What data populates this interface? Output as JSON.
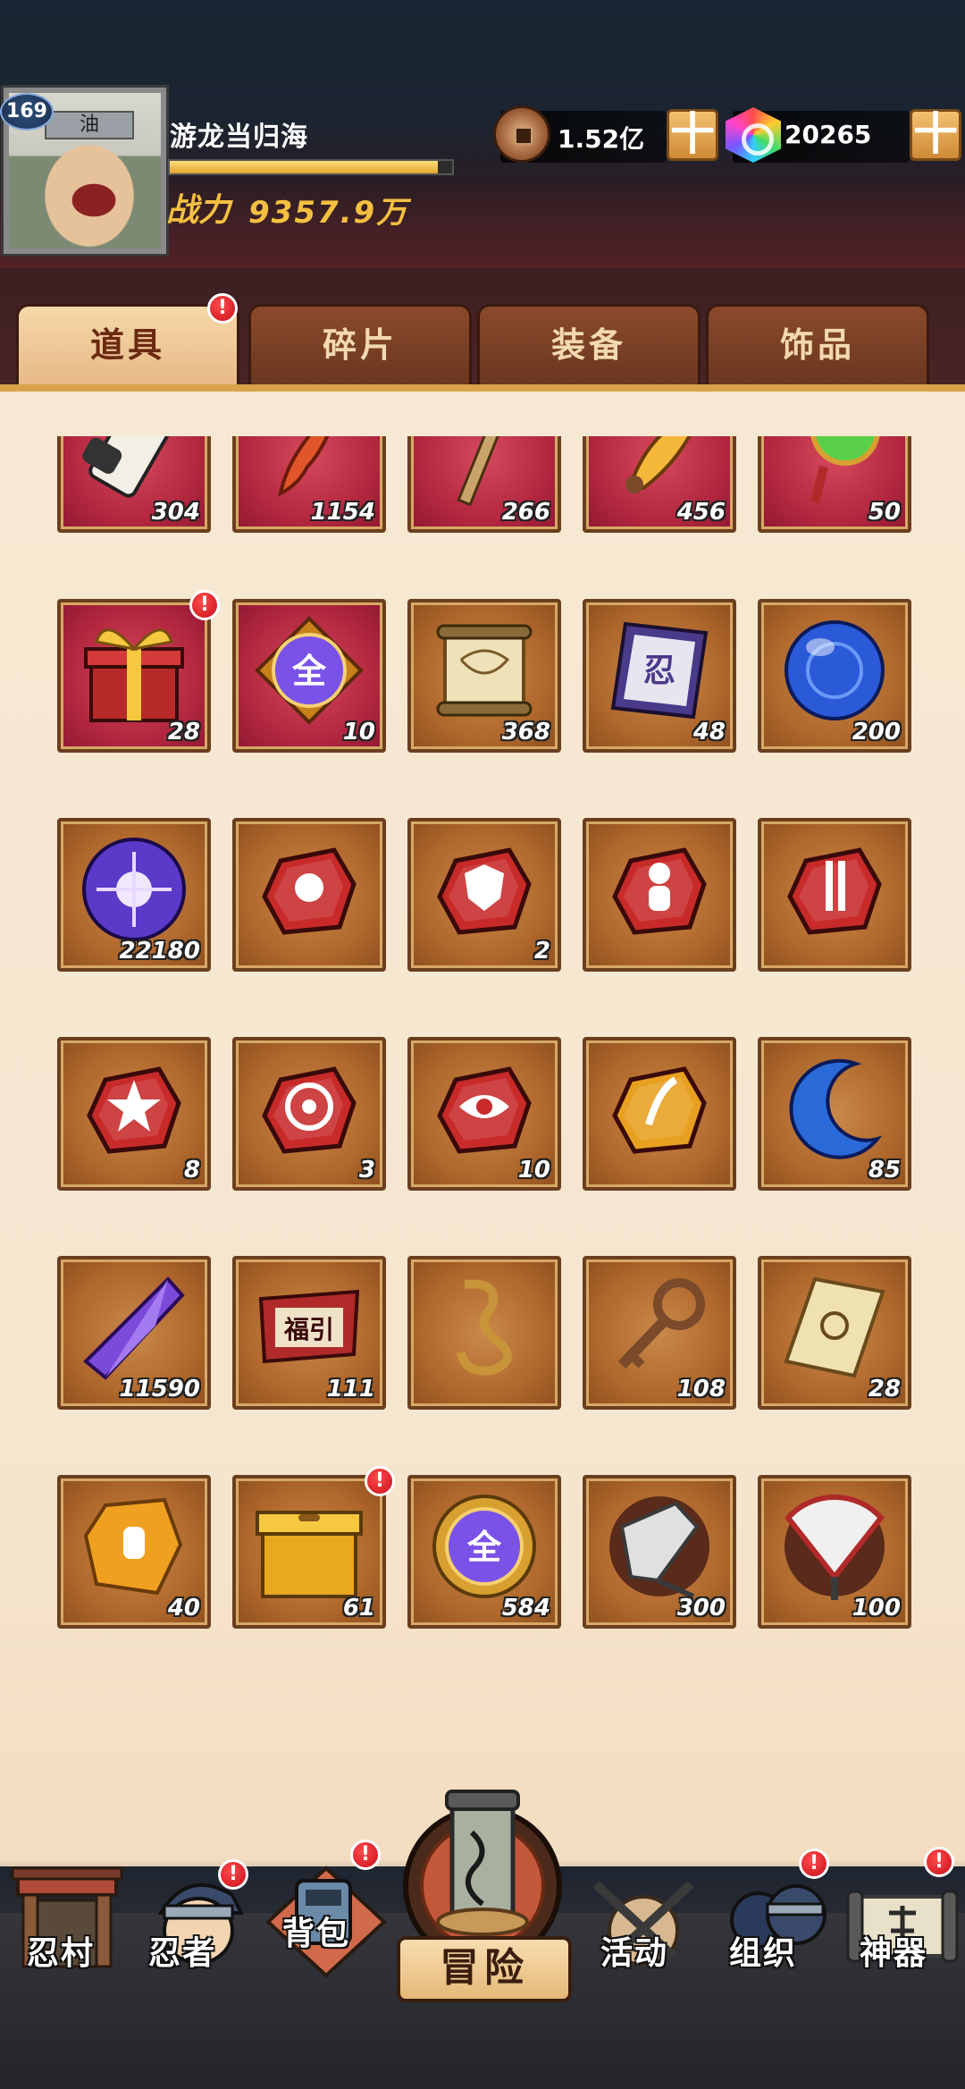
{
  "player": {
    "level": "169",
    "name": "游龙当归海",
    "power_label": "战力",
    "power_value": "9357.9万",
    "exp_fraction": 0.95,
    "avatar_band_text": "油"
  },
  "currencies": {
    "coins": {
      "amount": "1.52亿",
      "icon": "copper-coin-icon"
    },
    "gems": {
      "amount": "20265",
      "icon": "rainbow-gem-icon"
    },
    "plus_symbol": "十"
  },
  "tabs": [
    {
      "label": "道具",
      "active": true,
      "badge": "!"
    },
    {
      "label": "碎片",
      "active": false
    },
    {
      "label": "装备",
      "active": false
    },
    {
      "label": "饰品",
      "active": false
    }
  ],
  "items": [
    {
      "count": "304",
      "bg": "red",
      "icon": "scroll-icon"
    },
    {
      "count": "1154",
      "bg": "red",
      "icon": "flame-feather-icon"
    },
    {
      "count": "266",
      "bg": "red",
      "icon": "stick-icon"
    },
    {
      "count": "456",
      "bg": "red",
      "icon": "golden-feather-icon"
    },
    {
      "count": "50",
      "bg": "red",
      "icon": "green-jade-icon"
    },
    {
      "count": "28",
      "bg": "red",
      "icon": "gift-box-icon",
      "badge": "!"
    },
    {
      "count": "10",
      "bg": "red",
      "icon": "purple-orb-quan-icon",
      "orb_text": "全"
    },
    {
      "count": "368",
      "bg": "brown",
      "icon": "map-scroll-icon"
    },
    {
      "count": "48",
      "bg": "brown",
      "icon": "talisman-icon"
    },
    {
      "count": "200",
      "bg": "brown",
      "icon": "blue-orb-icon"
    },
    {
      "count": "22180",
      "bg": "brown",
      "icon": "purple-energy-orb-icon"
    },
    {
      "count": "",
      "bg": "brown",
      "icon": "red-stone-fist-icon"
    },
    {
      "count": "2",
      "bg": "brown",
      "icon": "red-stone-shield-icon"
    },
    {
      "count": "",
      "bg": "brown",
      "icon": "red-stone-figure-icon"
    },
    {
      "count": "",
      "bg": "brown",
      "icon": "red-stone-kunai-icon"
    },
    {
      "count": "8",
      "bg": "brown",
      "icon": "red-stone-burst-icon"
    },
    {
      "count": "3",
      "bg": "brown",
      "icon": "red-stone-target-icon"
    },
    {
      "count": "10",
      "bg": "brown",
      "icon": "red-stone-eye-icon"
    },
    {
      "count": "",
      "bg": "brown",
      "icon": "gold-stone-icon"
    },
    {
      "count": "85",
      "bg": "brown",
      "icon": "blue-moon-icon"
    },
    {
      "count": "11590",
      "bg": "brown",
      "icon": "purple-crystal-icon"
    },
    {
      "count": "111",
      "bg": "brown",
      "icon": "fortune-banner-icon",
      "banner_text": "福引"
    },
    {
      "count": "",
      "bg": "brown",
      "icon": "rope-icon"
    },
    {
      "count": "108",
      "bg": "brown",
      "icon": "key-icon"
    },
    {
      "count": "28",
      "bg": "brown",
      "icon": "parchment-icon"
    },
    {
      "count": "40",
      "bg": "brown",
      "icon": "amber-stone-icon"
    },
    {
      "count": "61",
      "bg": "brown",
      "icon": "golden-box-icon",
      "badge": "!"
    },
    {
      "count": "584",
      "bg": "brown",
      "icon": "purple-orb-gold-quan-icon",
      "orb_text": "全"
    },
    {
      "count": "300",
      "bg": "brown",
      "icon": "silver-blade-icon"
    },
    {
      "count": "100",
      "bg": "brown",
      "icon": "war-fan-icon"
    }
  ],
  "nav": [
    {
      "label": "忍村",
      "icon": "village-gate-icon"
    },
    {
      "label": "忍者",
      "icon": "ninja-head-icon",
      "badge": "!"
    },
    {
      "label": "背包",
      "icon": "backpack-icon",
      "badge": "!"
    },
    {
      "label": "冒险",
      "icon": "adventure-scroll-icon"
    },
    {
      "label": "活动",
      "icon": "crossed-kunai-icon"
    },
    {
      "label": "组织",
      "icon": "organization-icon",
      "badge": "!"
    },
    {
      "label": "神器",
      "icon": "artifact-scroll-icon",
      "badge": "!"
    }
  ],
  "colors": {
    "accent_gold": "#f5c040",
    "badge_red": "#c8101c",
    "tab_active": "#f6d8a8",
    "item_brown": "#b0682c",
    "item_red": "#b42840"
  }
}
